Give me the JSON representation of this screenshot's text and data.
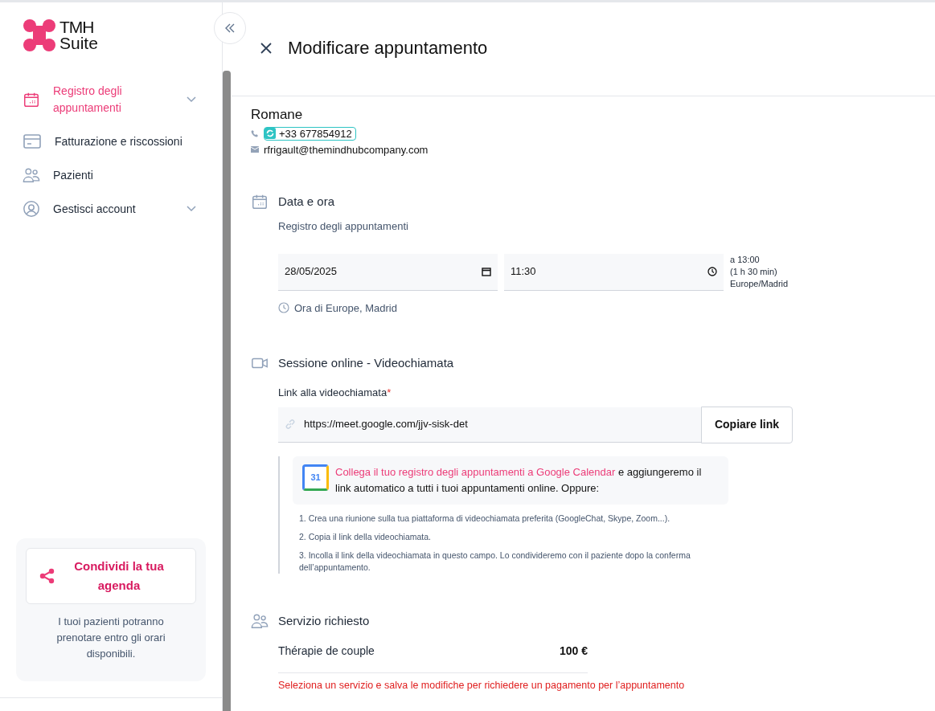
{
  "logo": {
    "line_1": "TMH",
    "line_2": "Suite"
  },
  "sidebar": {
    "items": [
      {
        "label": "Registro degli appuntamenti",
        "selected": true,
        "expandable": true
      },
      {
        "label": "Fatturazione e riscossioni",
        "selected": false,
        "expandable": false
      },
      {
        "label": "Pazienti",
        "selected": false,
        "expandable": false
      },
      {
        "label": "Gestisci account",
        "selected": false,
        "expandable": true
      }
    ],
    "share_card": {
      "button": "Condividi la tua agenda",
      "text": "I tuoi pazienti potranno prenotare entro gli orari disponibili."
    }
  },
  "header": {
    "title": "Modificare appuntamento"
  },
  "patient": {
    "name": "Romane",
    "phone": "+33 677854912",
    "email": "rfrigault@themindhubcompany.com"
  },
  "date_time": {
    "title": "Data e ora",
    "subtitle": "Registro degli appuntamenti",
    "date": "28/05/2025",
    "time": "11:30",
    "end_lines": [
      "a 13:00",
      "(1 h 30 min)",
      "Europe/Madrid"
    ],
    "timezone": "Ora di Europe, Madrid"
  },
  "online_session": {
    "title": "Sessione online - Videochiamata",
    "link_label": "Link alla videochiamata",
    "required_mark": "*",
    "link": "https://meet.google.com/jjv-sisk-det",
    "copy_button": "Copiare link",
    "calendar_day": "31",
    "calendar_link": "Collega il tuo registro degli appuntamenti a Google Calendar",
    "calendar_text": " e aggiungeremo il link automatico a tutti i tuoi appuntamenti online. Oppure:",
    "steps": [
      "1. Crea una riunione sulla tua piattaforma di videochiamata preferita (GoogleChat, Skype, Zoom...).",
      "2. Copia il link della videochiamata.",
      "3. Incolla il link della videochiamata in questo campo. Lo condivideremo con il paziente dopo la conferma dell’appuntamento."
    ]
  },
  "service": {
    "title": "Servizio richiesto",
    "name": "Thérapie de couple",
    "price": "100 €",
    "warning": "Seleziona un servizio e salva le modifiche per richiedere un pagamento per l’appuntamento"
  }
}
